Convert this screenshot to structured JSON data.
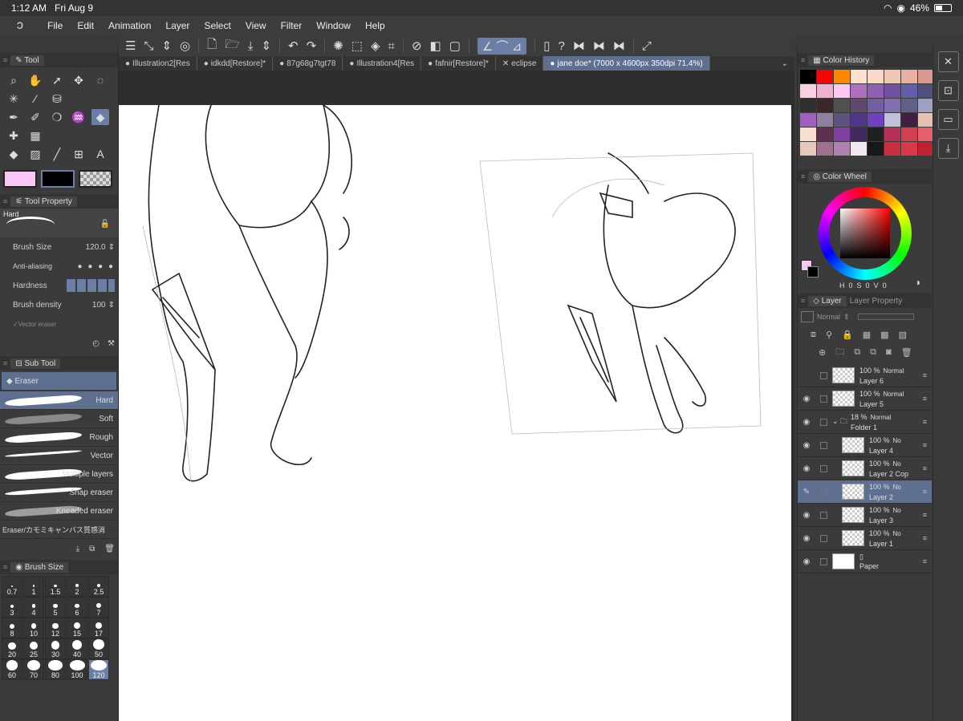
{
  "status": {
    "time": "1:12 AM",
    "date": "Fri Aug 9",
    "battery": "46%"
  },
  "menu": [
    "File",
    "Edit",
    "Animation",
    "Layer",
    "Select",
    "View",
    "Filter",
    "Window",
    "Help"
  ],
  "tool_panel": {
    "title": "Tool",
    "tools": [
      "magnifier-icon",
      "hand-icon",
      "select-arrow-icon",
      "move-icon",
      "lasso-icon",
      "magic-wand-icon",
      "eyedropper-icon",
      "bucket-small-icon",
      "",
      "",
      "pen-icon",
      "marker-icon",
      "blend-icon",
      "airbrush-icon",
      "eraser-icon",
      "sparkle-icon",
      "grid-icon",
      "",
      "",
      "",
      "fill-icon",
      "gradient-icon",
      "line-icon",
      "frame-icon",
      "text-icon"
    ],
    "colors": {
      "main": "#f9c7f5",
      "sub": "#000000"
    }
  },
  "tool_property": {
    "title": "Tool Property",
    "preset": "Hard",
    "brush_size_label": "Brush Size",
    "brush_size_value": "120.0",
    "anti_aliasing_label": "Anti-aliasing",
    "hardness_label": "Hardness",
    "brush_density_label": "Brush density",
    "brush_density_value": "100",
    "vector_eraser_label": "Vector eraser"
  },
  "sub_tool": {
    "title": "Sub Tool",
    "group": "Eraser",
    "items": [
      "Hard",
      "Soft",
      "Rough",
      "Vector",
      "Multiple layers",
      "Snap eraser",
      "Kneaded eraser",
      "Eraser/カモミキャンバス質感消"
    ]
  },
  "brush_size": {
    "title": "Brush Size",
    "sizes": [
      "0.7",
      "1",
      "1.5",
      "2",
      "2.5",
      "3",
      "4",
      "5",
      "6",
      "7",
      "8",
      "10",
      "12",
      "15",
      "17",
      "20",
      "25",
      "30",
      "40",
      "50",
      "60",
      "70",
      "80",
      "100",
      "120"
    ],
    "selected": "120"
  },
  "doc_tabs": [
    "Illustration2[Res",
    "idkdd[Restore]*",
    "87g68g7tgt78",
    "Illustration4[Res",
    "fafnir[Restore]*",
    "eclipse",
    "jane doe* (7000 x 4600px 350dpi 71.4%)"
  ],
  "color_history": {
    "title": "Color History",
    "colors": [
      "#000000",
      "#ff0000",
      "#ff8800",
      "#ffe0c8",
      "#f8d8c8",
      "#f0c8b0",
      "#e8b0a0",
      "#d89890",
      "#f8d0e0",
      "#f0b0d0",
      "#f8c8f0",
      "#b070c0",
      "#9060b0",
      "#7050a0",
      "#6060a8",
      "#505080",
      "#303030",
      "#3a2828",
      "#505050",
      "#604870",
      "#7060a0",
      "#8070b0",
      "#606088",
      "#a0a0c0",
      "#a060c0",
      "#9080a0",
      "#605080",
      "#503888",
      "#7040c0",
      "#c0c0d8",
      "#402040",
      "#e8c0b0",
      "#f8e0d0",
      "#603050",
      "#8040a0",
      "#402860",
      "#202020",
      "#b83058",
      "#d04050",
      "#e86070",
      "#e8c8b8",
      "#a07090",
      "#b080b0",
      "#f0e8f0",
      "#181818",
      "#c83040",
      "#d83848",
      "#c02030"
    ]
  },
  "color_wheel": {
    "title": "Color Wheel",
    "h_label": "H",
    "h": "0",
    "s_label": "S",
    "s": "0",
    "v_label": "V",
    "v": "0"
  },
  "layer_panel": {
    "tab_layer": "Layer",
    "tab_property": "Layer Property",
    "blend": "Normal",
    "layers": [
      {
        "name": "Layer 6",
        "opacity": "100 %",
        "mode": "Normal",
        "visible": false,
        "selected": false,
        "indent": false,
        "type": "raster"
      },
      {
        "name": "Layer 5",
        "opacity": "100 %",
        "mode": "Normal",
        "visible": true,
        "selected": false,
        "indent": false,
        "type": "raster"
      },
      {
        "name": "Folder 1",
        "opacity": "18 %",
        "mode": "Normal",
        "visible": true,
        "selected": false,
        "indent": false,
        "type": "folder"
      },
      {
        "name": "Layer 4",
        "opacity": "100 %",
        "mode": "No",
        "visible": true,
        "selected": false,
        "indent": true,
        "type": "raster"
      },
      {
        "name": "Layer 2 Cop",
        "opacity": "100 %",
        "mode": "No",
        "visible": true,
        "selected": false,
        "indent": true,
        "type": "raster"
      },
      {
        "name": "Layer 2",
        "opacity": "100 %",
        "mode": "No",
        "visible": false,
        "selected": true,
        "indent": true,
        "type": "raster"
      },
      {
        "name": "Layer 3",
        "opacity": "100 %",
        "mode": "No",
        "visible": true,
        "selected": false,
        "indent": true,
        "type": "raster"
      },
      {
        "name": "Layer 1",
        "opacity": "100 %",
        "mode": "No",
        "visible": true,
        "selected": false,
        "indent": true,
        "type": "raster"
      },
      {
        "name": "Paper",
        "opacity": "",
        "mode": "",
        "visible": true,
        "selected": false,
        "indent": false,
        "type": "paper"
      }
    ]
  }
}
